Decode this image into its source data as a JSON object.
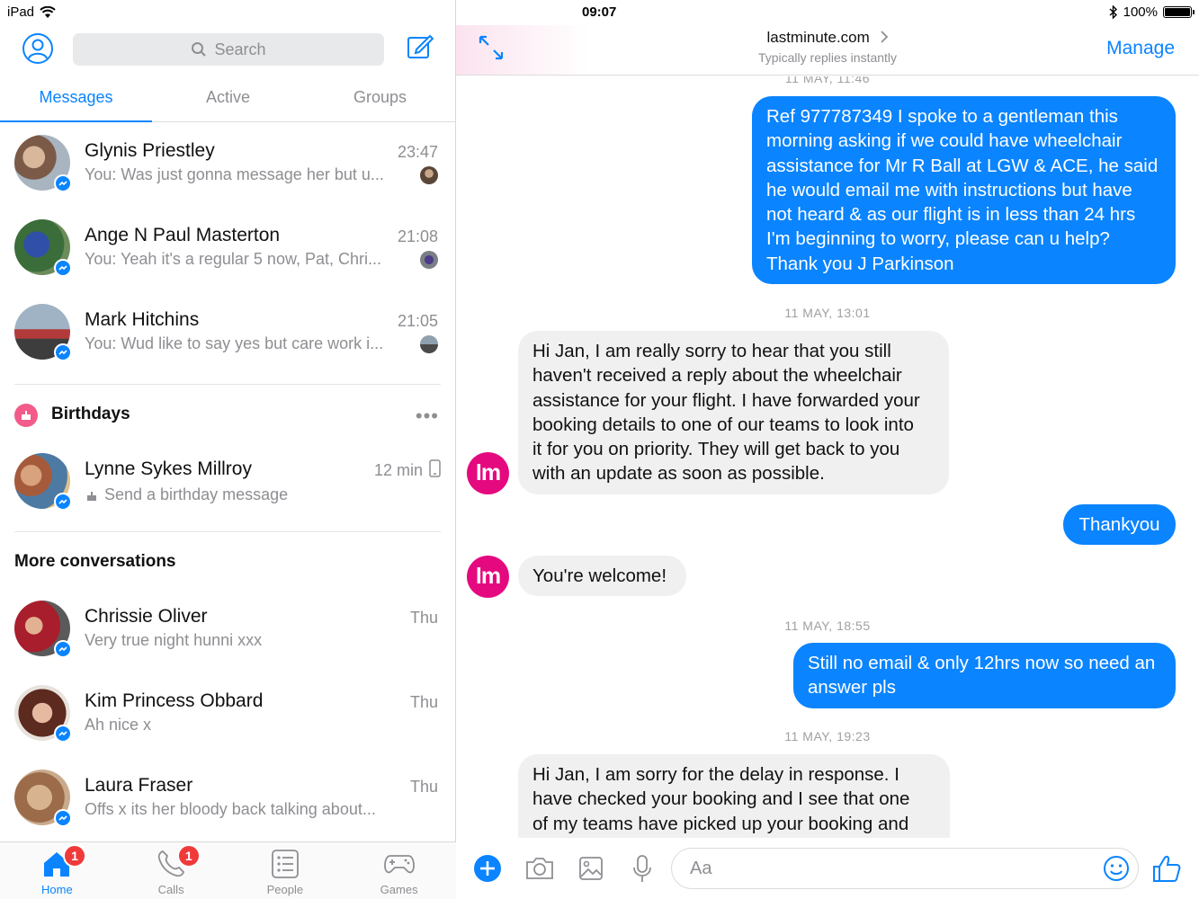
{
  "status_bar": {
    "device": "iPad",
    "time": "09:07",
    "battery": "100%",
    "battery_level": 1.0
  },
  "left_panel": {
    "search_placeholder": "Search",
    "tabs": [
      {
        "label": "Messages",
        "active": true
      },
      {
        "label": "Active",
        "active": false
      },
      {
        "label": "Groups",
        "active": false
      }
    ],
    "conversations": [
      {
        "name": "Glynis Priestley",
        "time": "23:47",
        "preview": "You: Was just gonna message her but u..."
      },
      {
        "name": "Ange N Paul Masterton",
        "time": "21:08",
        "preview": "You: Yeah it's a regular 5 now, Pat, Chri..."
      },
      {
        "name": "Mark Hitchins",
        "time": "21:05",
        "preview": "You: Wud like to say yes but care work i..."
      }
    ],
    "birthdays": {
      "title": "Birthdays",
      "more_label": "•••",
      "item": {
        "name": "Lynne Sykes Millroy",
        "time": "12 min",
        "preview": "Send a birthday message"
      }
    },
    "more_conversations": {
      "title": "More conversations",
      "items": [
        {
          "name": "Chrissie Oliver",
          "time": "Thu",
          "preview": "Very true night hunni xxx"
        },
        {
          "name": "Kim Princess Obbard",
          "time": "Thu",
          "preview": "Ah nice x"
        },
        {
          "name": "Laura Fraser",
          "time": "Thu",
          "preview": "Offs x its her bloody back talking about..."
        }
      ]
    },
    "bottom_tabs": [
      {
        "label": "Home",
        "badge": "1",
        "icon": "home-icon",
        "active": true
      },
      {
        "label": "Calls",
        "badge": "1",
        "icon": "phone-icon",
        "active": false
      },
      {
        "label": "People",
        "badge": "",
        "icon": "people-list-icon",
        "active": false
      },
      {
        "label": "Games",
        "badge": "",
        "icon": "gamepad-icon",
        "active": false
      }
    ]
  },
  "chat": {
    "title": "lastminute.com",
    "subtitle": "Typically replies instantly",
    "manage_label": "Manage",
    "avatar_initials": "lm",
    "stamps": [
      "11 MAY, 11:46",
      "11 MAY, 13:01",
      "11 MAY, 18:55",
      "11 MAY, 19:23"
    ],
    "messages": [
      {
        "side": "out",
        "text": "Ref 977787349 I spoke to a gentleman this\nmorning asking if we could have wheelchair\nassistance for Mr R Ball at LGW & ACE, he said\nhe would email me with instructions but have\nnot heard & as our flight is in less than 24 hrs\nI'm beginning to worry, please can u help?\nThank you J Parkinson"
      },
      {
        "side": "in",
        "text": "Hi Jan, I am really sorry to hear that you still\nhaven't received a reply about the wheelchair\nassistance for your flight. I have forwarded your\nbooking details to one of our teams to look into\nit for you on priority. They will get back to you\nwith an update as soon as possible."
      },
      {
        "side": "out",
        "text": "Thankyou"
      },
      {
        "side": "in",
        "text": "You're welcome!"
      },
      {
        "side": "out",
        "text": "Still no email & only 12hrs now so need an\nanswer pls"
      },
      {
        "side": "in",
        "text": "Hi Jan, I am sorry for the delay in response. I\nhave checked your booking and I see that one\nof my teams have picked up your booking and"
      }
    ],
    "composer_placeholder": "Aa"
  },
  "colors": {
    "accent": "#0a84ff",
    "lastminute_brand": "#e5097f",
    "badge_red": "#f03a3a"
  }
}
